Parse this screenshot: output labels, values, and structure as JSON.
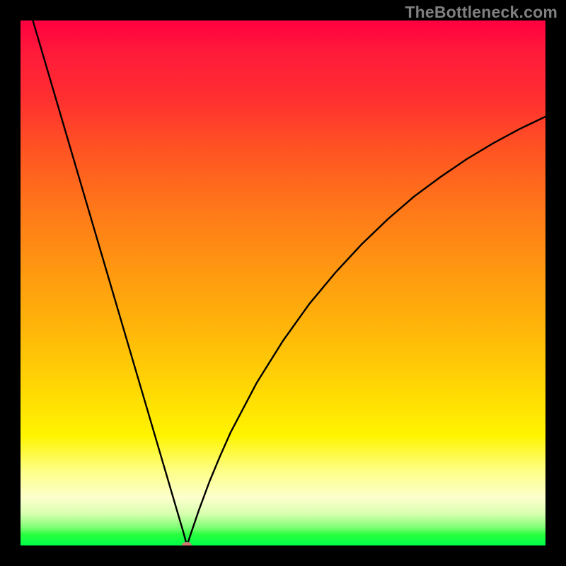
{
  "watermark": "TheBottleneck.com",
  "colors": {
    "frame": "#000000",
    "curve_stroke": "#000000",
    "marker_fill": "#cc7a73",
    "gradient_top": "#ff0040",
    "gradient_bottom": "#00ff49"
  },
  "chart_data": {
    "type": "line",
    "title": "",
    "xlabel": "",
    "ylabel": "",
    "xlim": [
      0,
      100
    ],
    "ylim": [
      0,
      100
    ],
    "x": [
      0,
      5,
      10,
      15,
      20,
      25,
      28,
      30,
      31,
      31.7,
      32.5,
      34,
      36,
      38,
      40,
      45,
      50,
      55,
      60,
      65,
      70,
      75,
      80,
      85,
      90,
      95,
      100
    ],
    "values": [
      108,
      91,
      74,
      57,
      40,
      23,
      12.8,
      6,
      2.6,
      0,
      2.4,
      6.8,
      12.2,
      17,
      21.5,
      31,
      39,
      46,
      52,
      57.4,
      62.2,
      66.5,
      70.2,
      73.6,
      76.6,
      79.3,
      81.7
    ],
    "minimum_point": {
      "x": 31.7,
      "y": 0
    },
    "annotations": []
  }
}
